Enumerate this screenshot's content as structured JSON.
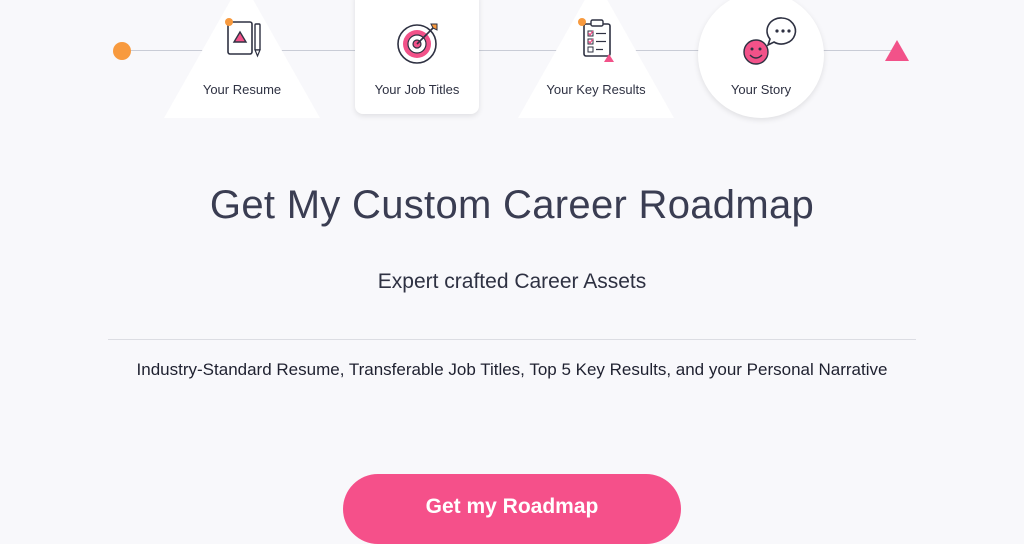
{
  "steps": [
    {
      "label": "Your Resume",
      "icon": "resume-icon",
      "shape": "triangle"
    },
    {
      "label": "Your Job Titles",
      "icon": "target-icon",
      "shape": "card"
    },
    {
      "label": "Your Key Results",
      "icon": "clipboard-checklist-icon",
      "shape": "triangle"
    },
    {
      "label": "Your Story",
      "icon": "chat-smiley-icon",
      "shape": "circle"
    }
  ],
  "heading": "Get My Custom Career Roadmap",
  "subheading": "Expert crafted Career Assets",
  "description": "Industry-Standard Resume, Transferable Job Titles, Top 5 Key Results, and your Personal Narrative",
  "cta_label": "Get my Roadmap",
  "colors": {
    "accent_pink": "#f5508a",
    "accent_orange": "#f89a3e",
    "text": "#2e3142",
    "background": "#f8f8fb"
  }
}
